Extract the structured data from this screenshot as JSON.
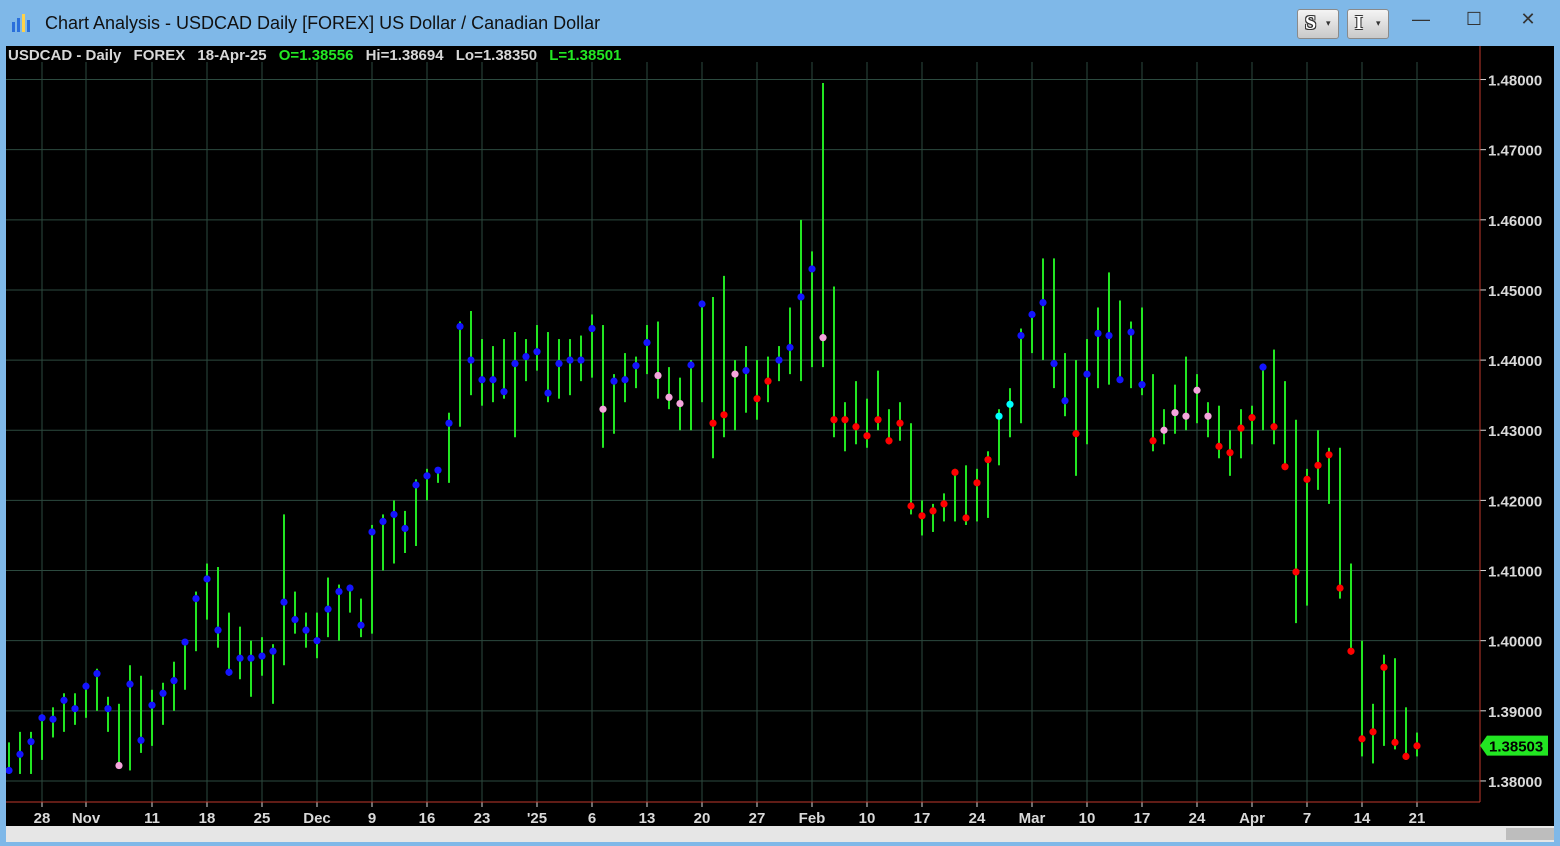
{
  "window": {
    "title": "Chart Analysis - USDCAD Daily [FOREX] US Dollar / Canadian Dollar",
    "buttons": {
      "s_label": "S",
      "i_label": "I",
      "dropdown_glyph": "▾"
    },
    "controls": {
      "minimize": "—",
      "maximize": "☐",
      "close": "✕"
    }
  },
  "header": {
    "symbol": "USDCAD - Daily",
    "exchange": "FOREX",
    "date": "18-Apr-25",
    "open": "O=1.38556",
    "high": "Hi=1.38694",
    "low": "Lo=1.38350",
    "last": "L=1.38501"
  },
  "colors": {
    "background": "#000000",
    "grid": "#2c4a3f",
    "bar": "#22e622",
    "axis_line": "#c0392b",
    "label_text": "#d9d9d9",
    "last_price_bg": "#22e622",
    "dot_blue": "#1414ff",
    "dot_red": "#ff0000",
    "dot_pink": "#f5a5dc",
    "dot_cyan": "#00ffff"
  },
  "chart_data": {
    "type": "bar",
    "subtype": "ohlc-range-with-close-dot",
    "ylim": [
      1.377,
      1.4825
    ],
    "yticks": [
      "1.38000",
      "1.39000",
      "1.40000",
      "1.41000",
      "1.42000",
      "1.43000",
      "1.44000",
      "1.45000",
      "1.46000",
      "1.47000",
      "1.48000"
    ],
    "last_price_label": "1.38503",
    "grid": true,
    "xlabels": [
      {
        "i": 3,
        "t": "28"
      },
      {
        "i": 7,
        "t": "Nov"
      },
      {
        "i": 13,
        "t": "11"
      },
      {
        "i": 18,
        "t": "18"
      },
      {
        "i": 23,
        "t": "25"
      },
      {
        "i": 28,
        "t": "Dec"
      },
      {
        "i": 33,
        "t": "9"
      },
      {
        "i": 38,
        "t": "16"
      },
      {
        "i": 43,
        "t": "23"
      },
      {
        "i": 48,
        "t": "'25"
      },
      {
        "i": 53,
        "t": "6"
      },
      {
        "i": 58,
        "t": "13"
      },
      {
        "i": 63,
        "t": "20"
      },
      {
        "i": 68,
        "t": "27"
      },
      {
        "i": 73,
        "t": "Feb"
      },
      {
        "i": 78,
        "t": "10"
      },
      {
        "i": 83,
        "t": "17"
      },
      {
        "i": 88,
        "t": "24"
      },
      {
        "i": 93,
        "t": "Mar"
      },
      {
        "i": 98,
        "t": "10"
      },
      {
        "i": 103,
        "t": "17"
      },
      {
        "i": 108,
        "t": "24"
      },
      {
        "i": 113,
        "t": "Apr"
      },
      {
        "i": 118,
        "t": "7"
      },
      {
        "i": 123,
        "t": "14"
      },
      {
        "i": 128,
        "t": "21"
      }
    ],
    "bars": [
      {
        "h": 1.3855,
        "l": 1.381,
        "c": 1.3815,
        "m": "b"
      },
      {
        "h": 1.387,
        "l": 1.381,
        "c": 1.3838,
        "m": "b"
      },
      {
        "h": 1.387,
        "l": 1.381,
        "c": 1.3856,
        "m": "b"
      },
      {
        "h": 1.3895,
        "l": 1.383,
        "c": 1.389,
        "m": "b"
      },
      {
        "h": 1.3905,
        "l": 1.3862,
        "c": 1.3888,
        "m": "b"
      },
      {
        "h": 1.3925,
        "l": 1.387,
        "c": 1.3915,
        "m": "b"
      },
      {
        "h": 1.3925,
        "l": 1.388,
        "c": 1.3903,
        "m": "b"
      },
      {
        "h": 1.394,
        "l": 1.389,
        "c": 1.3935,
        "m": "b"
      },
      {
        "h": 1.396,
        "l": 1.39,
        "c": 1.3953,
        "m": "b"
      },
      {
        "h": 1.392,
        "l": 1.387,
        "c": 1.3903,
        "m": "b"
      },
      {
        "h": 1.391,
        "l": 1.382,
        "c": 1.3822,
        "m": "p"
      },
      {
        "h": 1.3965,
        "l": 1.3815,
        "c": 1.3938,
        "m": "b"
      },
      {
        "h": 1.395,
        "l": 1.384,
        "c": 1.3858,
        "m": "b"
      },
      {
        "h": 1.393,
        "l": 1.385,
        "c": 1.3908,
        "m": "b"
      },
      {
        "h": 1.394,
        "l": 1.388,
        "c": 1.3925,
        "m": "b"
      },
      {
        "h": 1.397,
        "l": 1.39,
        "c": 1.3943,
        "m": "b"
      },
      {
        "h": 1.4,
        "l": 1.393,
        "c": 1.3998,
        "m": "b"
      },
      {
        "h": 1.407,
        "l": 1.3985,
        "c": 1.406,
        "m": "b"
      },
      {
        "h": 1.411,
        "l": 1.403,
        "c": 1.4088,
        "m": "b"
      },
      {
        "h": 1.4105,
        "l": 1.399,
        "c": 1.4015,
        "m": "b"
      },
      {
        "h": 1.404,
        "l": 1.395,
        "c": 1.3955,
        "m": "b"
      },
      {
        "h": 1.402,
        "l": 1.3945,
        "c": 1.3975,
        "m": "b"
      },
      {
        "h": 1.4,
        "l": 1.392,
        "c": 1.3975,
        "m": "b"
      },
      {
        "h": 1.4005,
        "l": 1.395,
        "c": 1.3978,
        "m": "b"
      },
      {
        "h": 1.3995,
        "l": 1.391,
        "c": 1.3985,
        "m": "b"
      },
      {
        "h": 1.418,
        "l": 1.3965,
        "c": 1.4055,
        "m": "b"
      },
      {
        "h": 1.407,
        "l": 1.401,
        "c": 1.403,
        "m": "b"
      },
      {
        "h": 1.404,
        "l": 1.399,
        "c": 1.4015,
        "m": "b"
      },
      {
        "h": 1.404,
        "l": 1.3975,
        "c": 1.4,
        "m": "b"
      },
      {
        "h": 1.409,
        "l": 1.4005,
        "c": 1.4045,
        "m": "b"
      },
      {
        "h": 1.408,
        "l": 1.4,
        "c": 1.407,
        "m": "b"
      },
      {
        "h": 1.408,
        "l": 1.404,
        "c": 1.4075,
        "m": "b"
      },
      {
        "h": 1.406,
        "l": 1.4005,
        "c": 1.4022,
        "m": "b"
      },
      {
        "h": 1.4165,
        "l": 1.401,
        "c": 1.4155,
        "m": "b"
      },
      {
        "h": 1.418,
        "l": 1.41,
        "c": 1.417,
        "m": "b"
      },
      {
        "h": 1.42,
        "l": 1.411,
        "c": 1.418,
        "m": "b"
      },
      {
        "h": 1.4185,
        "l": 1.4125,
        "c": 1.416,
        "m": "b"
      },
      {
        "h": 1.423,
        "l": 1.4135,
        "c": 1.4222,
        "m": "b"
      },
      {
        "h": 1.4245,
        "l": 1.42,
        "c": 1.4235,
        "m": "b"
      },
      {
        "h": 1.4245,
        "l": 1.4225,
        "c": 1.4243,
        "m": "b"
      },
      {
        "h": 1.4325,
        "l": 1.4225,
        "c": 1.431,
        "m": "b"
      },
      {
        "h": 1.4455,
        "l": 1.4305,
        "c": 1.4448,
        "m": "b"
      },
      {
        "h": 1.447,
        "l": 1.435,
        "c": 1.44,
        "m": "b"
      },
      {
        "h": 1.443,
        "l": 1.4335,
        "c": 1.4372,
        "m": "b"
      },
      {
        "h": 1.442,
        "l": 1.434,
        "c": 1.4372,
        "m": "b"
      },
      {
        "h": 1.443,
        "l": 1.4345,
        "c": 1.4355,
        "m": "b"
      },
      {
        "h": 1.444,
        "l": 1.429,
        "c": 1.4395,
        "m": "b"
      },
      {
        "h": 1.443,
        "l": 1.437,
        "c": 1.4405,
        "m": "b"
      },
      {
        "h": 1.445,
        "l": 1.4385,
        "c": 1.4412,
        "m": "b"
      },
      {
        "h": 1.444,
        "l": 1.434,
        "c": 1.4353,
        "m": "b"
      },
      {
        "h": 1.443,
        "l": 1.4345,
        "c": 1.4395,
        "m": "b"
      },
      {
        "h": 1.443,
        "l": 1.435,
        "c": 1.44,
        "m": "b"
      },
      {
        "h": 1.4435,
        "l": 1.437,
        "c": 1.44,
        "m": "b"
      },
      {
        "h": 1.4465,
        "l": 1.4375,
        "c": 1.4445,
        "m": "b"
      },
      {
        "h": 1.445,
        "l": 1.4275,
        "c": 1.433,
        "m": "p"
      },
      {
        "h": 1.438,
        "l": 1.4295,
        "c": 1.437,
        "m": "b"
      },
      {
        "h": 1.441,
        "l": 1.434,
        "c": 1.4372,
        "m": "b"
      },
      {
        "h": 1.4405,
        "l": 1.436,
        "c": 1.4392,
        "m": "b"
      },
      {
        "h": 1.445,
        "l": 1.438,
        "c": 1.4425,
        "m": "b"
      },
      {
        "h": 1.4455,
        "l": 1.4345,
        "c": 1.4378,
        "m": "p"
      },
      {
        "h": 1.439,
        "l": 1.433,
        "c": 1.4347,
        "m": "p"
      },
      {
        "h": 1.4375,
        "l": 1.43,
        "c": 1.4338,
        "m": "p"
      },
      {
        "h": 1.44,
        "l": 1.43,
        "c": 1.4393,
        "m": "b"
      },
      {
        "h": 1.4485,
        "l": 1.434,
        "c": 1.448,
        "m": "b"
      },
      {
        "h": 1.449,
        "l": 1.426,
        "c": 1.431,
        "m": "r"
      },
      {
        "h": 1.452,
        "l": 1.429,
        "c": 1.4322,
        "m": "r"
      },
      {
        "h": 1.44,
        "l": 1.43,
        "c": 1.438,
        "m": "p"
      },
      {
        "h": 1.442,
        "l": 1.4325,
        "c": 1.4385,
        "m": "b"
      },
      {
        "h": 1.44,
        "l": 1.4315,
        "c": 1.4345,
        "m": "r"
      },
      {
        "h": 1.4405,
        "l": 1.434,
        "c": 1.437,
        "m": "r"
      },
      {
        "h": 1.442,
        "l": 1.437,
        "c": 1.44,
        "m": "b"
      },
      {
        "h": 1.4475,
        "l": 1.438,
        "c": 1.4418,
        "m": "b"
      },
      {
        "h": 1.46,
        "l": 1.437,
        "c": 1.449,
        "m": "b"
      },
      {
        "h": 1.4555,
        "l": 1.439,
        "c": 1.453,
        "m": "b"
      },
      {
        "h": 1.4795,
        "l": 1.439,
        "c": 1.4432,
        "m": "p"
      },
      {
        "h": 1.4505,
        "l": 1.429,
        "c": 1.4315,
        "m": "r"
      },
      {
        "h": 1.434,
        "l": 1.427,
        "c": 1.4315,
        "m": "r"
      },
      {
        "h": 1.437,
        "l": 1.428,
        "c": 1.4305,
        "m": "r"
      },
      {
        "h": 1.4345,
        "l": 1.4275,
        "c": 1.4292,
        "m": "r"
      },
      {
        "h": 1.4385,
        "l": 1.43,
        "c": 1.4315,
        "m": "r"
      },
      {
        "h": 1.433,
        "l": 1.428,
        "c": 1.4285,
        "m": "r"
      },
      {
        "h": 1.434,
        "l": 1.4285,
        "c": 1.431,
        "m": "r"
      },
      {
        "h": 1.431,
        "l": 1.418,
        "c": 1.4192,
        "m": "r"
      },
      {
        "h": 1.42,
        "l": 1.415,
        "c": 1.4178,
        "m": "r"
      },
      {
        "h": 1.4195,
        "l": 1.4155,
        "c": 1.4185,
        "m": "r"
      },
      {
        "h": 1.421,
        "l": 1.417,
        "c": 1.4195,
        "m": "r"
      },
      {
        "h": 1.4245,
        "l": 1.417,
        "c": 1.424,
        "m": "r"
      },
      {
        "h": 1.425,
        "l": 1.4165,
        "c": 1.4175,
        "m": "r"
      },
      {
        "h": 1.4245,
        "l": 1.417,
        "c": 1.4225,
        "m": "r"
      },
      {
        "h": 1.427,
        "l": 1.4175,
        "c": 1.4258,
        "m": "r"
      },
      {
        "h": 1.433,
        "l": 1.425,
        "c": 1.432,
        "m": "c"
      },
      {
        "h": 1.436,
        "l": 1.429,
        "c": 1.4337,
        "m": "c"
      },
      {
        "h": 1.4445,
        "l": 1.431,
        "c": 1.4435,
        "m": "b"
      },
      {
        "h": 1.447,
        "l": 1.441,
        "c": 1.4465,
        "m": "b"
      },
      {
        "h": 1.4545,
        "l": 1.44,
        "c": 1.4482,
        "m": "b"
      },
      {
        "h": 1.4545,
        "l": 1.436,
        "c": 1.4395,
        "m": "b"
      },
      {
        "h": 1.441,
        "l": 1.432,
        "c": 1.4342,
        "m": "b"
      },
      {
        "h": 1.44,
        "l": 1.4235,
        "c": 1.4295,
        "m": "r"
      },
      {
        "h": 1.443,
        "l": 1.428,
        "c": 1.438,
        "m": "b"
      },
      {
        "h": 1.4475,
        "l": 1.436,
        "c": 1.4438,
        "m": "b"
      },
      {
        "h": 1.4525,
        "l": 1.4365,
        "c": 1.4435,
        "m": "b"
      },
      {
        "h": 1.4485,
        "l": 1.437,
        "c": 1.4372,
        "m": "b"
      },
      {
        "h": 1.4455,
        "l": 1.436,
        "c": 1.444,
        "m": "b"
      },
      {
        "h": 1.4475,
        "l": 1.435,
        "c": 1.4365,
        "m": "b"
      },
      {
        "h": 1.438,
        "l": 1.427,
        "c": 1.4285,
        "m": "r"
      },
      {
        "h": 1.433,
        "l": 1.428,
        "c": 1.43,
        "m": "p"
      },
      {
        "h": 1.4365,
        "l": 1.4295,
        "c": 1.4325,
        "m": "p"
      },
      {
        "h": 1.4405,
        "l": 1.43,
        "c": 1.432,
        "m": "p"
      },
      {
        "h": 1.438,
        "l": 1.431,
        "c": 1.4357,
        "m": "p"
      },
      {
        "h": 1.434,
        "l": 1.429,
        "c": 1.432,
        "m": "p"
      },
      {
        "h": 1.4335,
        "l": 1.426,
        "c": 1.4277,
        "m": "r"
      },
      {
        "h": 1.43,
        "l": 1.4235,
        "c": 1.4268,
        "m": "r"
      },
      {
        "h": 1.433,
        "l": 1.426,
        "c": 1.4303,
        "m": "r"
      },
      {
        "h": 1.4335,
        "l": 1.428,
        "c": 1.4318,
        "m": "r"
      },
      {
        "h": 1.4395,
        "l": 1.43,
        "c": 1.439,
        "m": "b"
      },
      {
        "h": 1.4415,
        "l": 1.428,
        "c": 1.4305,
        "m": "r"
      },
      {
        "h": 1.437,
        "l": 1.4245,
        "c": 1.4248,
        "m": "r"
      },
      {
        "h": 1.4315,
        "l": 1.4025,
        "c": 1.4098,
        "m": "r"
      },
      {
        "h": 1.4245,
        "l": 1.405,
        "c": 1.423,
        "m": "r"
      },
      {
        "h": 1.43,
        "l": 1.4215,
        "c": 1.425,
        "m": "r"
      },
      {
        "h": 1.4275,
        "l": 1.4195,
        "c": 1.4265,
        "m": "r"
      },
      {
        "h": 1.4275,
        "l": 1.406,
        "c": 1.4075,
        "m": "r"
      },
      {
        "h": 1.411,
        "l": 1.398,
        "c": 1.3985,
        "m": "r"
      },
      {
        "h": 1.4,
        "l": 1.3835,
        "c": 1.386,
        "m": "r"
      },
      {
        "h": 1.391,
        "l": 1.3825,
        "c": 1.387,
        "m": "r"
      },
      {
        "h": 1.398,
        "l": 1.385,
        "c": 1.3962,
        "m": "r"
      },
      {
        "h": 1.3975,
        "l": 1.3845,
        "c": 1.3855,
        "m": "r"
      },
      {
        "h": 1.3905,
        "l": 1.383,
        "c": 1.3835,
        "m": "r"
      },
      {
        "h": 1.3869,
        "l": 1.3835,
        "c": 1.385,
        "m": "r"
      }
    ]
  }
}
